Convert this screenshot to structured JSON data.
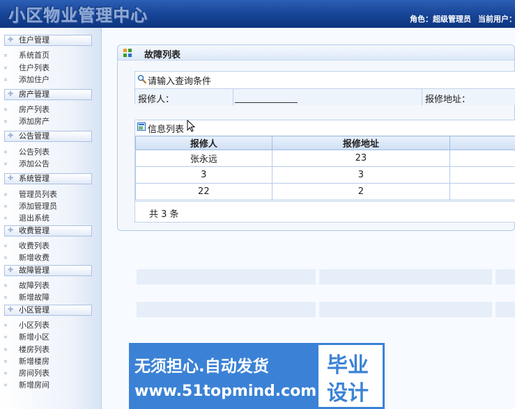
{
  "header": {
    "title": "小区物业管理中心",
    "role_label": "角色：超级管理员",
    "current_user_label": "当前用户：a"
  },
  "sidebar": {
    "groups": [
      {
        "title": "住户管理",
        "items": [
          "系统首页",
          "住户列表",
          "添加住户"
        ]
      },
      {
        "title": "房产管理",
        "items": [
          "房产列表",
          "添加房产"
        ]
      },
      {
        "title": "公告管理",
        "items": [
          "公告列表",
          "添加公告"
        ]
      },
      {
        "title": "系统管理",
        "items": [
          "管理员列表",
          "添加管理员",
          "退出系统"
        ]
      },
      {
        "title": "收费管理",
        "items": [
          "收费列表",
          "新增收费"
        ]
      },
      {
        "title": "故障管理",
        "items": [
          "故障列表",
          "新增故障"
        ]
      },
      {
        "title": "小区管理",
        "items": [
          "小区列表",
          "新增小区",
          "楼房列表",
          "新增楼房",
          "房间列表",
          "新增房间"
        ]
      }
    ]
  },
  "main": {
    "panel_title": "故障列表",
    "query": {
      "title": "请输入查询条件",
      "reporter_label": "报修人：",
      "reporter_value": "",
      "address_label": "报修地址："
    },
    "info": {
      "title": "信息列表",
      "columns": [
        "报修人",
        "报修地址",
        ""
      ],
      "rows": [
        [
          "张永远",
          "23",
          ""
        ],
        [
          "3",
          "3",
          ""
        ],
        [
          "22",
          "2",
          ""
        ]
      ],
      "total_text": "共 3 条"
    }
  },
  "watermark": {
    "line1": "无须担心.自动发货",
    "line2": "www.51topmind.com",
    "right_line1": "毕业",
    "right_line2": "设计"
  },
  "colors": {
    "header_bg": "#164394",
    "accent": "#3b82d6",
    "grid_border": "#9dbce4"
  }
}
